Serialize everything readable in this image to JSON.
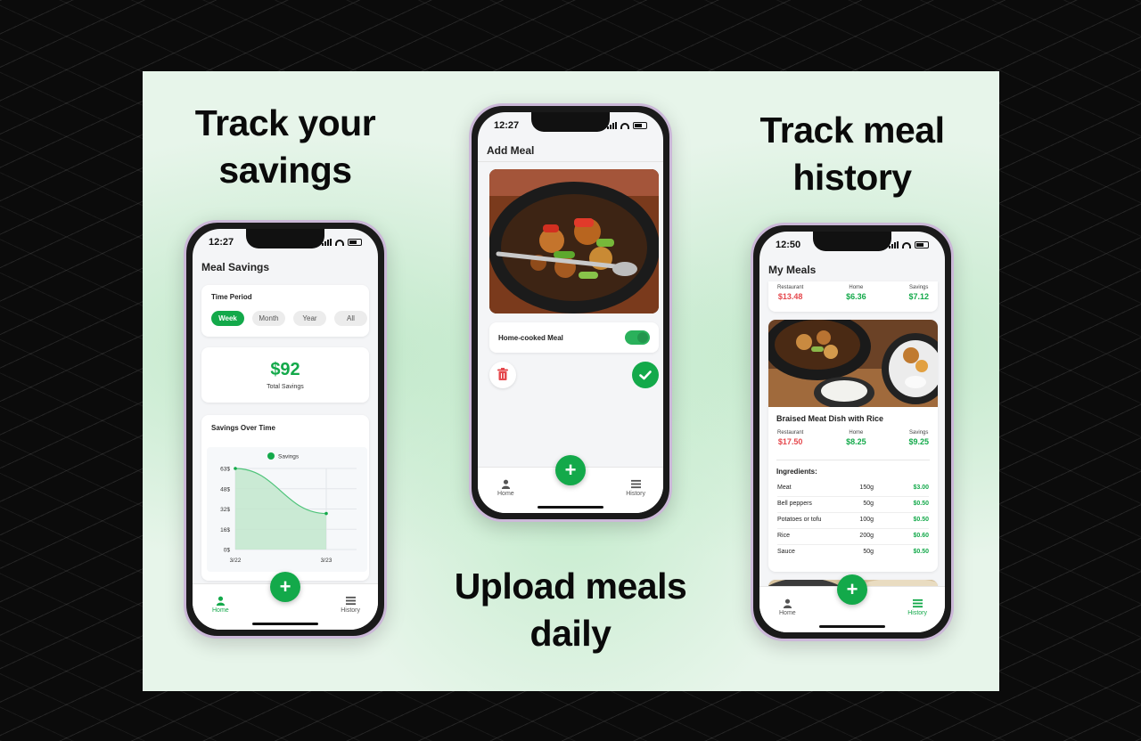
{
  "headlines": {
    "left": "Track your savings",
    "middle": "Upload meals daily",
    "right": "Track meal history"
  },
  "colors": {
    "accent": "#13a94a",
    "danger": "#e5484d"
  },
  "phone1": {
    "time": "12:27",
    "title": "Meal Savings",
    "time_period": {
      "label": "Time Period",
      "options": [
        "Week",
        "Month",
        "Year",
        "All"
      ],
      "selected": "Week"
    },
    "total": {
      "amount": "$92",
      "label": "Total Savings"
    },
    "chart_section_title": "Savings Over Time",
    "chart_data": {
      "type": "line",
      "legend": "Savings",
      "categories": [
        "3/22",
        "3/23"
      ],
      "series": [
        {
          "name": "Savings",
          "values": [
            63,
            28
          ]
        }
      ],
      "yticks": [
        "63$",
        "48$",
        "32$",
        "16$",
        "0$"
      ],
      "ylim": [
        0,
        63
      ]
    },
    "tabs": {
      "home": "Home",
      "history": "History",
      "active": "home"
    }
  },
  "phone2": {
    "time": "12:27",
    "title": "Add Meal",
    "toggle_label": "Home-cooked Meal",
    "toggle_on": true,
    "tabs": {
      "home": "Home",
      "history": "History",
      "active": "none"
    }
  },
  "phone3": {
    "time": "12:50",
    "title": "My Meals",
    "labels": {
      "restaurant": "Restaurant",
      "home": "Home",
      "savings": "Savings"
    },
    "first_meal": {
      "restaurant": "$13.48",
      "home": "$6.36",
      "savings": "$7.12"
    },
    "second_meal": {
      "name": "Braised Meat Dish with Rice",
      "restaurant": "$17.50",
      "home": "$8.25",
      "savings": "$9.25",
      "ingredients_title": "Ingredients:",
      "ingredients": [
        {
          "name": "Meat",
          "qty": "150g",
          "cost": "$3.00"
        },
        {
          "name": "Bell peppers",
          "qty": "50g",
          "cost": "$0.50"
        },
        {
          "name": "Potatoes or tofu",
          "qty": "100g",
          "cost": "$0.50"
        },
        {
          "name": "Rice",
          "qty": "200g",
          "cost": "$0.60"
        },
        {
          "name": "Sauce",
          "qty": "50g",
          "cost": "$0.50"
        }
      ]
    },
    "tabs": {
      "home": "Home",
      "history": "History",
      "active": "history"
    }
  }
}
